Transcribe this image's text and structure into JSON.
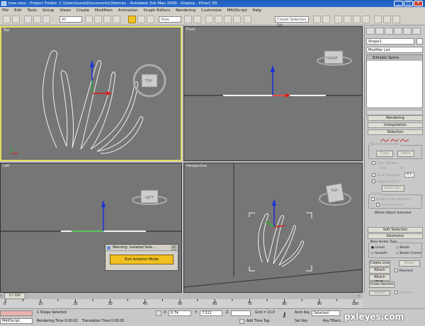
{
  "title_bar": {
    "text": "tree.max  - Project Folder: C:\\Users\\Love\\Documents\\3dsmax  - Autodesk 3ds Max  2009      - Display : Direct 3D"
  },
  "menu": [
    "File",
    "Edit",
    "Tools",
    "Group",
    "Views",
    "Create",
    "Modifiers",
    "Animation",
    "Graph Editors",
    "Rendering",
    "Customize",
    "MAXScript",
    "Help"
  ],
  "toolbar": {
    "filter": "All",
    "view": "View",
    "selection_set": "Create Selection Set"
  },
  "viewports": {
    "top": "Top",
    "front": "Front",
    "left": "Left",
    "perspective": "Perspective"
  },
  "viewcube": {
    "top": "TOP",
    "front": "FRONT",
    "left": "LEFT"
  },
  "command_panel": {
    "object_name": "Shape1",
    "modifier_list": "Modifier List",
    "stack_item": "Editable Spline",
    "rollouts": {
      "rendering": "Rendering",
      "interpolation": "Interpolation",
      "selection": "Selection",
      "soft_selection": "Soft Selection",
      "geometry": "Geometry"
    },
    "selection": {
      "named_selections": "Named Selections:",
      "copy": "Copy",
      "paste": "Paste",
      "lock_handles": "Lock Handles",
      "alike": "Alike",
      "all": "All",
      "area_selection": "Area Selection:",
      "area_value": "0.1",
      "segment_end": "Segment End",
      "select_by": "Select By...",
      "display": "Display",
      "show_vertex_numbers": "Show Vertex Numbers",
      "selected_only": "Selected Only",
      "whole_object_selected": "Whole Object Selected"
    },
    "geometry": {
      "new_vertex_type": "New Vertex Type",
      "linear": "Linear",
      "bezier": "Bezier",
      "smooth": "Smooth",
      "bezier_corner": "Bezier Corner",
      "create_line": "Create Line",
      "break": "Break",
      "attach": "Attach",
      "reorient": "Reorient",
      "attach_mult": "Attach Mult.",
      "cross_section": "Cross Section",
      "refine": "Refine",
      "connect": "Connect",
      "linear2": "Linear",
      "bind_first": "Bind first"
    }
  },
  "dialog": {
    "title": "Warning: Isolated Sele...",
    "button": "Exit Isolation Mode"
  },
  "time": {
    "frame": "0 / 100",
    "ticks": [
      "0",
      "10",
      "20",
      "30",
      "40",
      "50",
      "60",
      "70",
      "80",
      "90",
      "100"
    ]
  },
  "status": {
    "maxscript": "MAXScript.",
    "selection": "1 Shape Selected",
    "rendering_time": "Rendering Time  0:00:02",
    "translation_time": "Translation Time  0:00:00",
    "x_label": "X:",
    "x_value": "6.74",
    "y_label": "Y:",
    "y_value": "7.521",
    "z_label": "Z:",
    "grid": "Grid = 10.0",
    "add_time_tag": "Add Time Tag",
    "auto_key": "Auto Key",
    "selected": "Selected",
    "set_key": "Set Key",
    "key_filters": "Key Filters...",
    "watermark": "pxleyes.com"
  },
  "colors": {
    "active_border": "#e3dd60",
    "viewport_bg": "#767676",
    "dialog_button": "#f0c020"
  }
}
